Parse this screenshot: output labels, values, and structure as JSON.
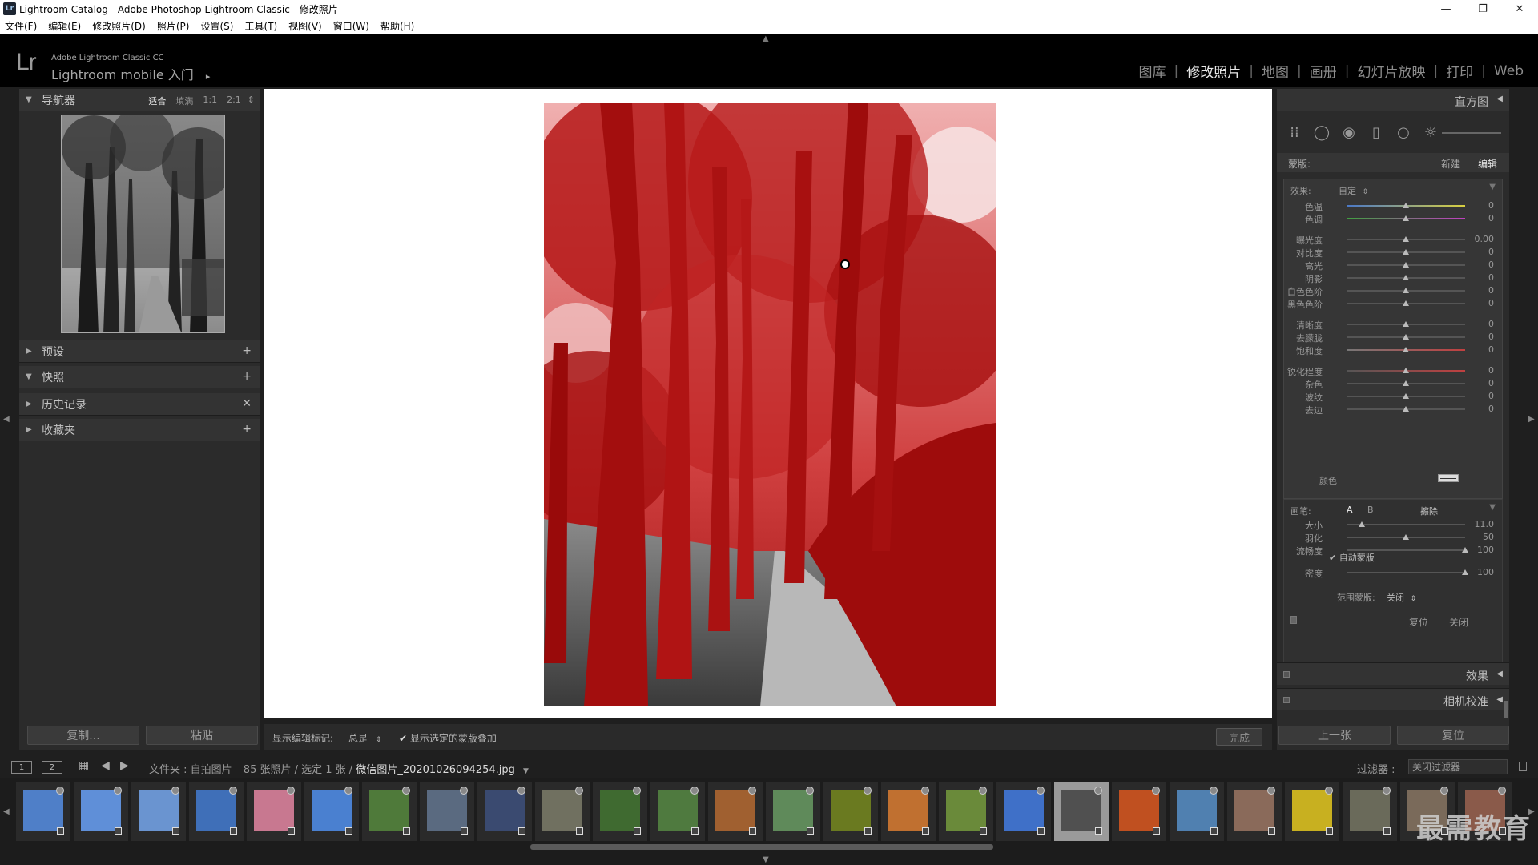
{
  "window": {
    "title": "Lightroom Catalog - Adobe Photoshop Lightroom Classic - 修改照片",
    "app_badge": "Lr",
    "controls": [
      "—",
      "❐",
      "✕"
    ]
  },
  "menu": [
    "文件(F)",
    "编辑(E)",
    "修改照片(D)",
    "照片(P)",
    "设置(S)",
    "工具(T)",
    "视图(V)",
    "窗口(W)",
    "帮助(H)"
  ],
  "identity": {
    "logo": "Lr",
    "product": "Adobe Lightroom Classic CC",
    "mobile": "Lightroom mobile 入门",
    "mobile_arrow": "▸"
  },
  "modules": [
    {
      "label": "图库",
      "active": false
    },
    {
      "label": "修改照片",
      "active": true
    },
    {
      "label": "地图",
      "active": false
    },
    {
      "label": "画册",
      "active": false
    },
    {
      "label": "幻灯片放映",
      "active": false
    },
    {
      "label": "打印",
      "active": false
    },
    {
      "label": "Web",
      "active": false
    }
  ],
  "left_panel": {
    "navigator": {
      "title": "导航器",
      "zoom": [
        "适合",
        "填满",
        "1:1",
        "2:1"
      ],
      "zoom_active": "适合",
      "zoom_menu": "⇕"
    },
    "sections": [
      {
        "title": "预设",
        "action": "+",
        "expanded": false
      },
      {
        "title": "快照",
        "action": "+",
        "expanded": true
      },
      {
        "title": "历史记录",
        "action": "✕",
        "expanded": false
      },
      {
        "title": "收藏夹",
        "action": "+",
        "expanded": false
      }
    ],
    "copy_button": "复制...",
    "paste_button": "粘贴"
  },
  "toolbar": {
    "show_markers_label": "显示编辑标记:",
    "show_markers_value": "总是",
    "overlay_checkbox": "显示选定的蒙版叠加",
    "overlay_checked": true,
    "done_button": "完成"
  },
  "right_panel": {
    "histogram": "直方图",
    "mask_label": "蒙版:",
    "mask_new": "新建",
    "mask_edit": "编辑",
    "effect_label": "效果:",
    "effect_value": "自定",
    "sliders": [
      {
        "label": "色温",
        "value": "0",
        "pos": 0.5
      },
      {
        "label": "色调",
        "value": "0",
        "pos": 0.5
      },
      {
        "label": "曝光度",
        "value": "0.00",
        "pos": 0.5
      },
      {
        "label": "对比度",
        "value": "0",
        "pos": 0.5
      },
      {
        "label": "高光",
        "value": "0",
        "pos": 0.5
      },
      {
        "label": "阴影",
        "value": "0",
        "pos": 0.5
      },
      {
        "label": "白色色阶",
        "value": "0",
        "pos": 0.5
      },
      {
        "label": "黑色色阶",
        "value": "0",
        "pos": 0.5
      },
      {
        "label": "清晰度",
        "value": "0",
        "pos": 0.5
      },
      {
        "label": "去朦胧",
        "value": "0",
        "pos": 0.5
      },
      {
        "label": "饱和度",
        "value": "0",
        "pos": 0.5
      },
      {
        "label": "锐化程度",
        "value": "0",
        "pos": 0.5
      },
      {
        "label": "杂色",
        "value": "0",
        "pos": 0.5
      },
      {
        "label": "波纹",
        "value": "0",
        "pos": 0.5
      },
      {
        "label": "去边",
        "value": "0",
        "pos": 0.5
      }
    ],
    "color_label": "颜色",
    "brush_label": "画笔:",
    "brush_a": "A",
    "brush_b": "B",
    "brush_erase": "擦除",
    "brush_sliders": [
      {
        "label": "大小",
        "value": "11.0",
        "pos": 0.13
      },
      {
        "label": "羽化",
        "value": "50",
        "pos": 0.5
      },
      {
        "label": "流畅度",
        "value": "100",
        "pos": 1.0
      },
      {
        "label": "密度",
        "value": "100",
        "pos": 1.0
      }
    ],
    "auto_mask": "自动蒙版",
    "auto_mask_checked": true,
    "range_mask_label": "范围蒙版:",
    "range_mask_value": "关闭",
    "reset": "复位",
    "close": "关闭",
    "effects_section": "效果",
    "calibration_section": "相机校准",
    "prev_button": "上一张",
    "reset_button": "复位"
  },
  "filmbar": {
    "monitor1": "1",
    "monitor2": "2",
    "path_prefix": "文件夹 : 自拍图片",
    "count": "85 张照片 / 选定 1 张 /",
    "filename": "微信图片_20201026094254.jpg",
    "filter_label": "过滤器 :",
    "filter_value": "关闭过滤器"
  },
  "filmstrip": {
    "selected_index": 18,
    "thumbs": [
      "#4f7fc8",
      "#5f8fd8",
      "#6a94d0",
      "#3f6fb8",
      "#c87890",
      "#4a80d0",
      "#4f7a3a",
      "#5a6a80",
      "#3a4a70",
      "#707060",
      "#3f6a30",
      "#4f7a3f",
      "#a06030",
      "#5f8a5a",
      "#6a7a20",
      "#c07030",
      "#6a8a3a",
      "#3f70c8",
      "#505050",
      "#c05020",
      "#5080b0",
      "#8a6a5a",
      "#c8b020",
      "#6a6a5a",
      "#7a6a5a",
      "#8a5a4a"
    ]
  },
  "watermark": "最需教育"
}
